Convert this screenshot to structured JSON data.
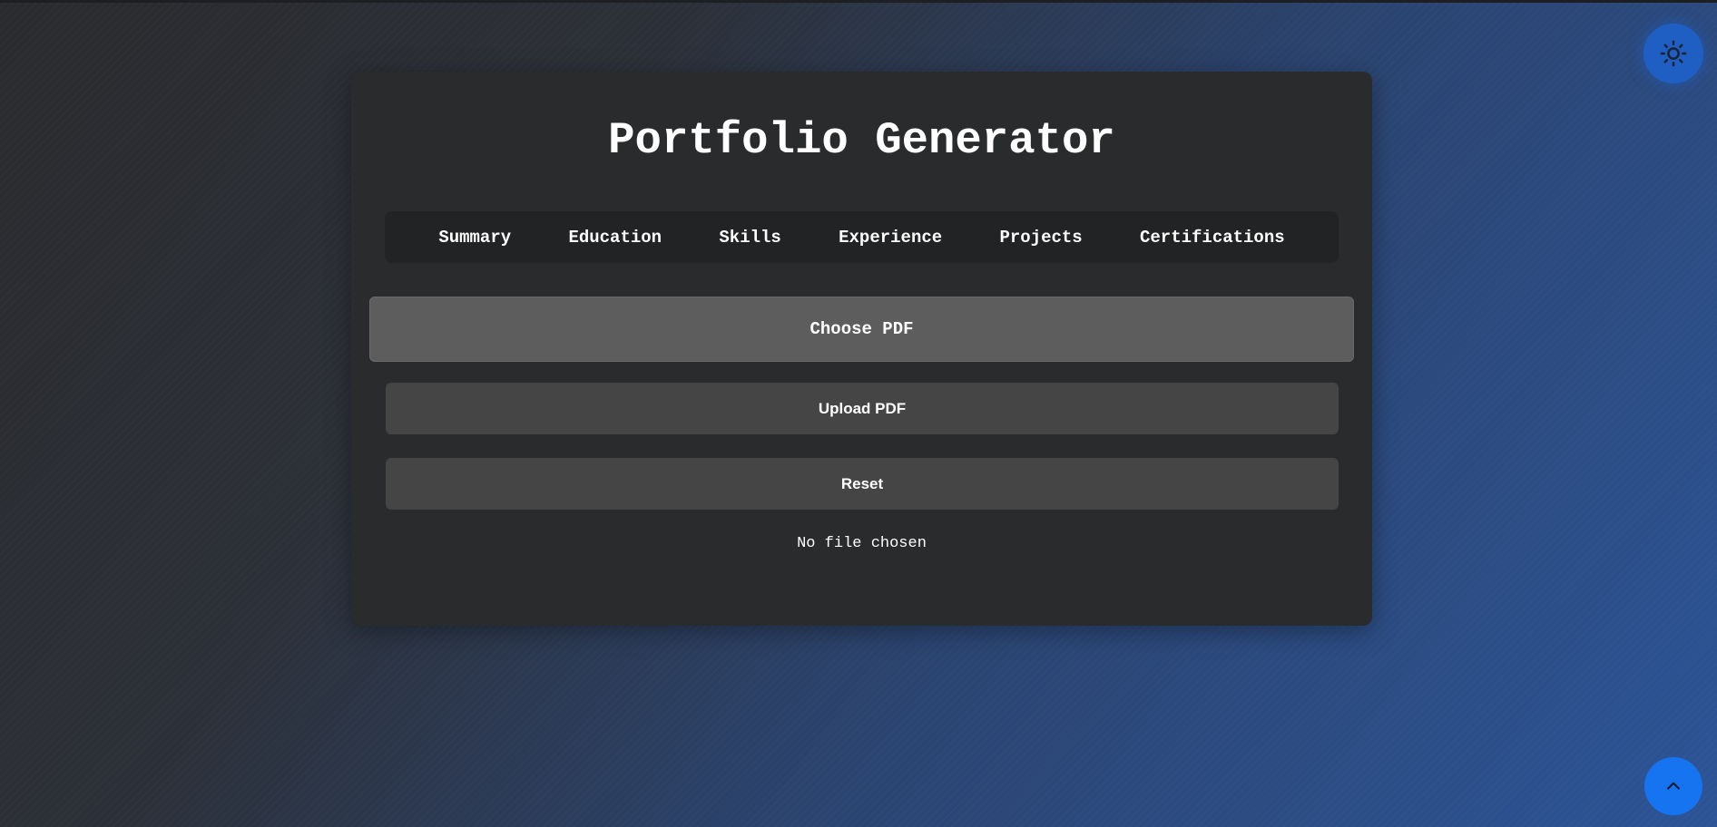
{
  "page": {
    "title": "Portfolio Generator"
  },
  "tabs": [
    {
      "label": "Summary"
    },
    {
      "label": "Education"
    },
    {
      "label": "Skills"
    },
    {
      "label": "Experience"
    },
    {
      "label": "Projects"
    },
    {
      "label": "Certifications"
    }
  ],
  "upload": {
    "choose_label": "Choose PDF",
    "upload_label": "Upload PDF",
    "reset_label": "Reset",
    "file_status": "No file chosen"
  },
  "controls": {
    "theme_toggle_icon": "sun-icon",
    "scroll_top_icon": "chevron-up-icon"
  },
  "colors": {
    "card_background": "#2a2b2d",
    "tabs_background": "#222324",
    "choose_button": "#5d5d5e",
    "action_button": "#454546",
    "theme_toggle": "#1f5fc4",
    "scroll_top": "#1674f0"
  }
}
